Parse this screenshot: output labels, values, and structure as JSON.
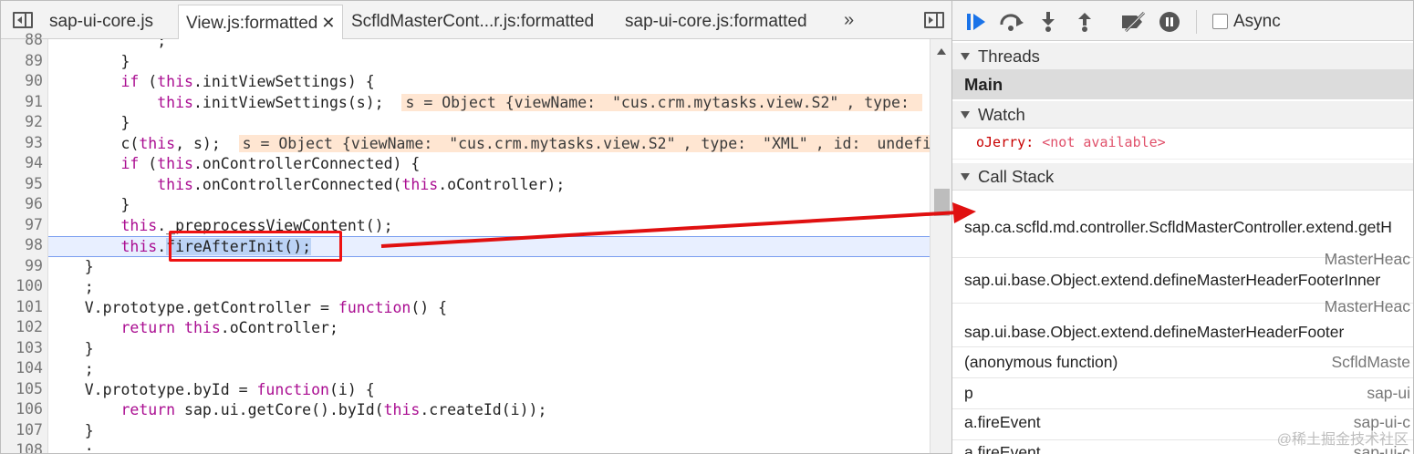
{
  "editor": {
    "tabs": [
      {
        "label": "sap-ui-core.js",
        "active": false
      },
      {
        "label": "View.js:formatted",
        "active": true
      },
      {
        "label": "ScfldMasterCont...r.js:formatted",
        "active": false
      },
      {
        "label": "sap-ui-core.js:formatted",
        "active": false
      }
    ],
    "close_glyph": "✕",
    "more_tabs_glyph": "»",
    "current_line": 98,
    "lines": [
      {
        "n": "88",
        "tokens": [
          {
            "t": "            ;"
          }
        ]
      },
      {
        "n": "89",
        "tokens": [
          {
            "t": "        }"
          }
        ]
      },
      {
        "n": "90",
        "tokens": [
          {
            "t": "        "
          },
          {
            "t": "if",
            "c": "kw"
          },
          {
            "t": " ("
          },
          {
            "t": "this",
            "c": "kw"
          },
          {
            "t": ".initViewSettings) {"
          }
        ]
      },
      {
        "n": "91",
        "tokens": [
          {
            "t": "            "
          },
          {
            "t": "this",
            "c": "kw"
          },
          {
            "t": ".initViewSettings(s);  "
          },
          {
            "t": "s = Object {viewName: ",
            "c": "inline-val"
          },
          {
            "t": "\"cus.crm.mytasks.view.S2\"",
            "c": "str inline-val"
          },
          {
            "t": ", type: ",
            "c": "inline-val"
          }
        ]
      },
      {
        "n": "92",
        "tokens": [
          {
            "t": "        }"
          }
        ]
      },
      {
        "n": "93",
        "tokens": [
          {
            "t": "        c("
          },
          {
            "t": "this",
            "c": "kw"
          },
          {
            "t": ", s);  "
          },
          {
            "t": "s = Object {viewName: ",
            "c": "inline-val"
          },
          {
            "t": "\"cus.crm.mytasks.view.S2\"",
            "c": "str inline-val"
          },
          {
            "t": ", type: ",
            "c": "inline-val"
          },
          {
            "t": "\"XML\"",
            "c": "str inline-val"
          },
          {
            "t": ", id: ",
            "c": "inline-val"
          },
          {
            "t": "undefi",
            "c": "undef inline-val"
          }
        ]
      },
      {
        "n": "94",
        "tokens": [
          {
            "t": "        "
          },
          {
            "t": "if",
            "c": "kw"
          },
          {
            "t": " ("
          },
          {
            "t": "this",
            "c": "kw"
          },
          {
            "t": ".onControllerConnected) {"
          }
        ]
      },
      {
        "n": "95",
        "tokens": [
          {
            "t": "            "
          },
          {
            "t": "this",
            "c": "kw"
          },
          {
            "t": ".onControllerConnected("
          },
          {
            "t": "this",
            "c": "kw"
          },
          {
            "t": ".oController);"
          }
        ]
      },
      {
        "n": "96",
        "tokens": [
          {
            "t": "        }"
          }
        ]
      },
      {
        "n": "97",
        "tokens": [
          {
            "t": "        "
          },
          {
            "t": "this",
            "c": "kw"
          },
          {
            "t": "._preprocessViewContent();"
          }
        ]
      },
      {
        "n": "98",
        "tokens": [
          {
            "t": "        "
          },
          {
            "t": "this",
            "c": "kw"
          },
          {
            "t": "."
          },
          {
            "t": "fireAfterInit();",
            "c": "sel"
          }
        ]
      },
      {
        "n": "99",
        "tokens": [
          {
            "t": "    }"
          }
        ]
      },
      {
        "n": "100",
        "tokens": [
          {
            "t": "    ;"
          }
        ]
      },
      {
        "n": "101",
        "tokens": [
          {
            "t": "    V.prototype.getController = "
          },
          {
            "t": "function",
            "c": "kw"
          },
          {
            "t": "() {"
          }
        ]
      },
      {
        "n": "102",
        "tokens": [
          {
            "t": "        "
          },
          {
            "t": "return",
            "c": "kw"
          },
          {
            "t": " "
          },
          {
            "t": "this",
            "c": "kw"
          },
          {
            "t": ".oController;"
          }
        ]
      },
      {
        "n": "103",
        "tokens": [
          {
            "t": "    }"
          }
        ]
      },
      {
        "n": "104",
        "tokens": [
          {
            "t": "    ;"
          }
        ]
      },
      {
        "n": "105",
        "tokens": [
          {
            "t": "    V.prototype.byId = "
          },
          {
            "t": "function",
            "c": "kw"
          },
          {
            "t": "(i) {"
          }
        ]
      },
      {
        "n": "106",
        "tokens": [
          {
            "t": "        "
          },
          {
            "t": "return",
            "c": "kw"
          },
          {
            "t": " sap.ui.getCore().byId("
          },
          {
            "t": "this",
            "c": "kw"
          },
          {
            "t": ".createId(i));"
          }
        ]
      },
      {
        "n": "107",
        "tokens": [
          {
            "t": "    }"
          }
        ]
      },
      {
        "n": "108",
        "tokens": [
          {
            "t": "    ;"
          }
        ]
      }
    ]
  },
  "debugger": {
    "async_label": "Async",
    "async_checked": false,
    "threads": {
      "title": "Threads",
      "main_label": "Main"
    },
    "watch": {
      "title": "Watch",
      "expression": "oJerry",
      "value": "<not available>"
    },
    "call_stack": {
      "title": "Call Stack",
      "frames": [
        {
          "fn": "sap.ca.scfld.md.controller.ScfldMasterController.extend.getH",
          "loc": ""
        },
        {
          "fn": "sap.ui.base.Object.extend.defineMasterHeaderFooterInner",
          "loc": "MasterHeac"
        },
        {
          "fn": "sap.ui.base.Object.extend.defineMasterHeaderFooter",
          "loc": "MasterHeac"
        },
        {
          "fn": "(anonymous function)",
          "loc": "ScfldMaste"
        },
        {
          "fn": "p",
          "loc": "sap-ui"
        },
        {
          "fn": "a.fireEvent",
          "loc": "sap-ui-c"
        },
        {
          "fn": "a.fireEvent",
          "loc": "sap-ui-c"
        }
      ]
    }
  },
  "icons": {
    "nav_left": "toggle-navigator-icon",
    "nav_right": "toggle-debugger-icon",
    "resume": "resume-icon",
    "step_over": "step-over-icon",
    "step_into": "step-into-icon",
    "step_out": "step-out-icon",
    "deactivate": "deactivate-breakpoints-icon",
    "pause_exceptions": "pause-on-exceptions-icon"
  },
  "colors": {
    "annotation": "#e01010",
    "keyword": "#aa0d91",
    "string": "#c41a16",
    "current_line": "#e8efff"
  },
  "watermark": "@稀土掘金技术社区"
}
